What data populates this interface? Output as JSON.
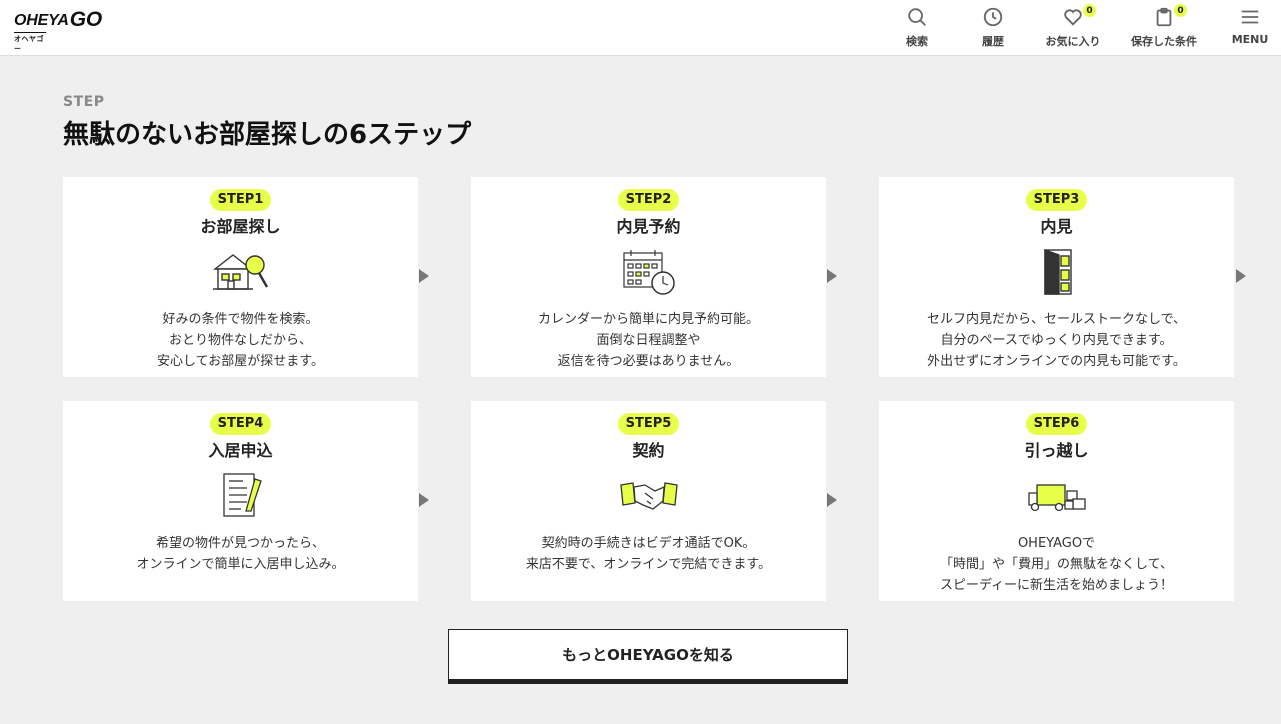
{
  "header": {
    "logo_main": "OHEYA",
    "logo_go": "GO",
    "logo_sub": "オヘヤゴー",
    "nav": [
      {
        "label": "検索",
        "icon": "search-icon"
      },
      {
        "label": "履歴",
        "icon": "clock-icon"
      },
      {
        "label": "お気に入り",
        "icon": "heart-icon",
        "badge": "0"
      },
      {
        "label": "保存した条件",
        "icon": "clipboard-icon",
        "badge": "0"
      },
      {
        "label": "MENU",
        "icon": "hamburger-icon"
      }
    ]
  },
  "section": {
    "eyebrow": "STEP",
    "title": "無駄のないお部屋探しの6ステップ"
  },
  "steps": [
    {
      "step": "STEP1",
      "title": "お部屋探し",
      "icon": "house-magnifier-icon",
      "lines": [
        "好みの条件で物件を検索。",
        "おとり物件なしだから、",
        "安心してお部屋が探せます。"
      ]
    },
    {
      "step": "STEP2",
      "title": "内見予約",
      "icon": "calendar-clock-icon",
      "lines": [
        "カレンダーから簡単に内見予約可能。",
        "面倒な日程調整や",
        "返信を待つ必要はありません。"
      ]
    },
    {
      "step": "STEP3",
      "title": "内見",
      "icon": "door-icon",
      "lines": [
        "セルフ内見だから、セールストークなしで、",
        "自分のペースでゆっくり内見できます。",
        "外出せずにオンラインでの内見も可能です。"
      ]
    },
    {
      "step": "STEP4",
      "title": "入居申込",
      "icon": "form-pen-icon",
      "lines": [
        "希望の物件が見つかったら、",
        "オンラインで簡単に入居申し込み。"
      ]
    },
    {
      "step": "STEP5",
      "title": "契約",
      "icon": "handshake-icon",
      "lines": [
        "契約時の手続きはビデオ通話でOK。",
        "来店不要で、オンラインで完結できます。"
      ]
    },
    {
      "step": "STEP6",
      "title": "引っ越し",
      "icon": "truck-icon",
      "lines": [
        "OHEYAGOで",
        "「時間」や「費用」の無駄をなくして、",
        "スピーディーに新生活を始めましょう！"
      ]
    }
  ],
  "cta": {
    "label": "もっとOHEYAGOを知る"
  },
  "colors": {
    "accent": "#e8ff4a",
    "background": "#efefef"
  }
}
